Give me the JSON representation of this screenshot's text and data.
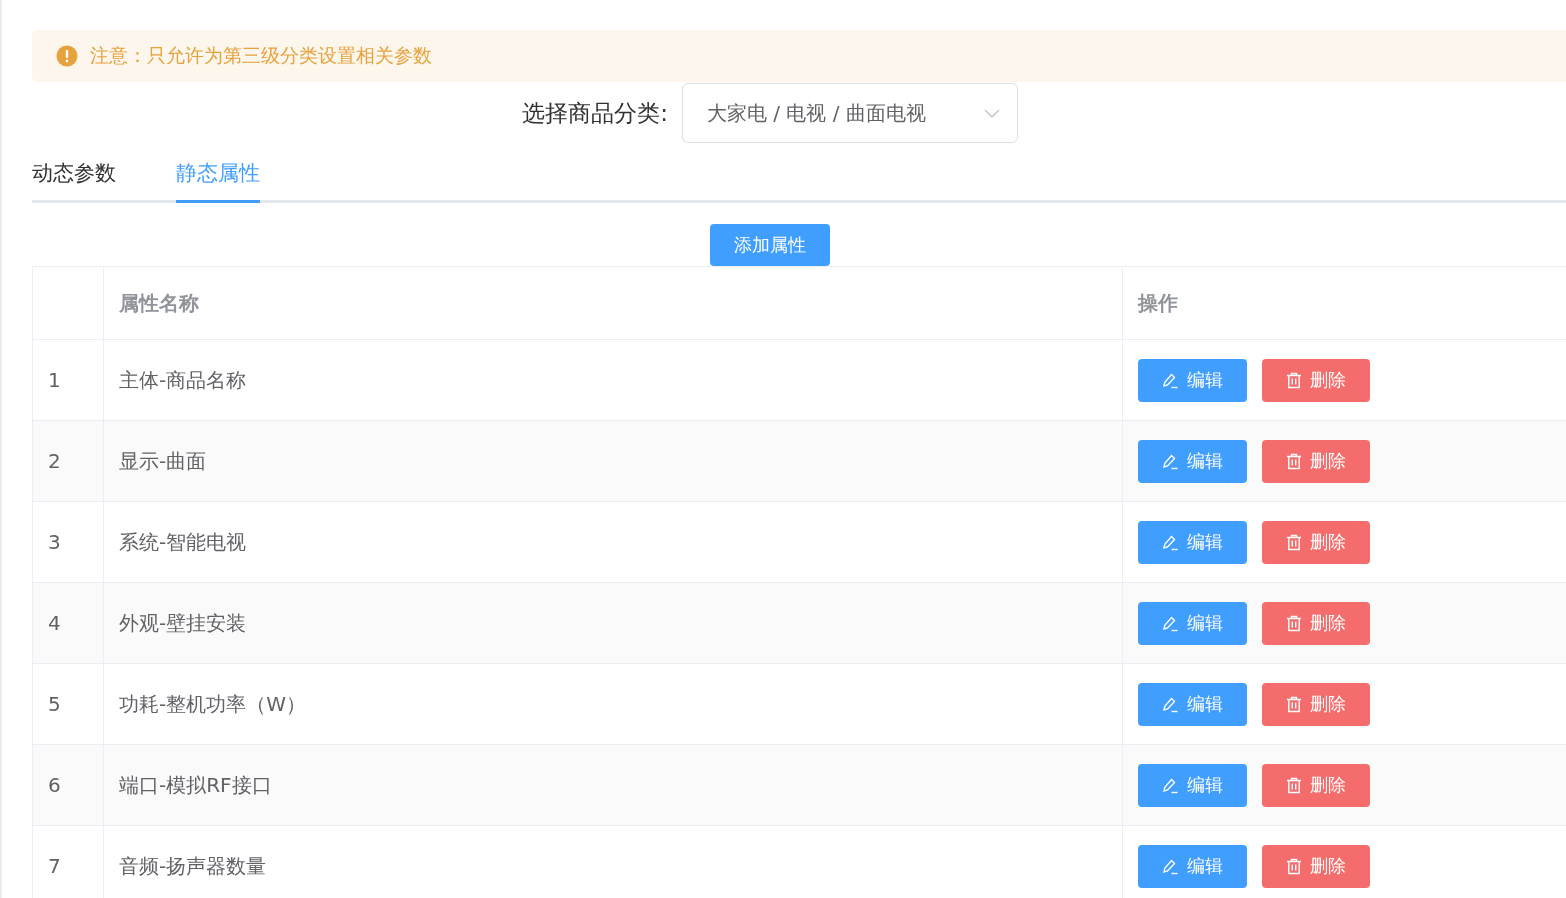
{
  "alert": {
    "text": "注意：只允许为第三级分类设置相关参数"
  },
  "category_select": {
    "label": "选择商品分类:",
    "value": "大家电 / 电视 / 曲面电视"
  },
  "tabs": [
    {
      "label": "动态参数",
      "selected": false
    },
    {
      "label": "静态属性",
      "selected": true
    }
  ],
  "add_button": "添加属性",
  "table": {
    "columns": [
      "属性名称",
      "操作"
    ],
    "rows": [
      {
        "index": "1",
        "name": "主体-商品名称",
        "actions": [
          {
            "kind": "edit",
            "label": "编辑"
          },
          {
            "kind": "delete",
            "label": "删除"
          }
        ]
      },
      {
        "index": "2",
        "name": "显示-曲面",
        "actions": [
          {
            "kind": "edit",
            "label": "编辑"
          },
          {
            "kind": "delete",
            "label": "删除"
          }
        ]
      },
      {
        "index": "3",
        "name": "系统-智能电视",
        "actions": [
          {
            "kind": "edit",
            "label": "编辑"
          },
          {
            "kind": "delete",
            "label": "删除"
          }
        ]
      },
      {
        "index": "4",
        "name": "外观-壁挂安装",
        "actions": [
          {
            "kind": "edit",
            "label": "编辑"
          },
          {
            "kind": "delete",
            "label": "删除"
          }
        ]
      },
      {
        "index": "5",
        "name": "功耗-整机功率（W）",
        "actions": [
          {
            "kind": "edit",
            "label": "编辑"
          },
          {
            "kind": "delete",
            "label": "删除"
          }
        ]
      },
      {
        "index": "6",
        "name": "端口-模拟RF接口",
        "actions": [
          {
            "kind": "edit",
            "label": "编辑"
          },
          {
            "kind": "delete",
            "label": "删除"
          }
        ]
      },
      {
        "index": "7",
        "name": "音频-扬声器数量",
        "actions": [
          {
            "kind": "edit",
            "label": "编辑"
          },
          {
            "kind": "delete",
            "label": "删除"
          }
        ]
      }
    ]
  }
}
